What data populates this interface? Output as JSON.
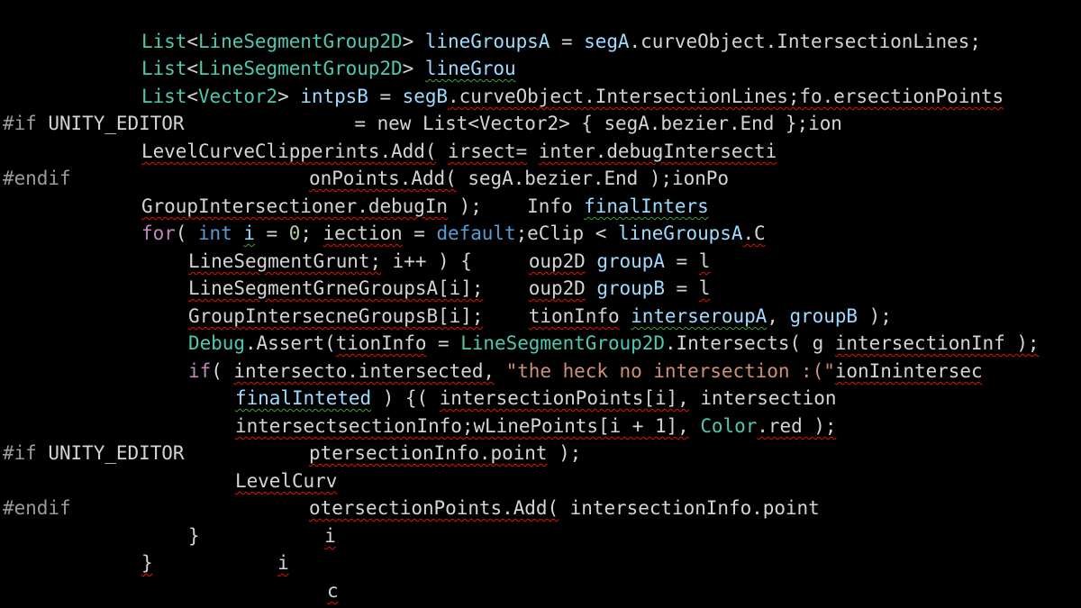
{
  "editor": {
    "theme_colors": {
      "background": "#000000",
      "type": "#4ec9b0",
      "keyword": "#569cd6",
      "control_keyword": "#c586c0",
      "variable": "#9cdcfe",
      "function": "#dcdcaa",
      "string": "#ce9178",
      "number": "#b5cea8",
      "preprocessor": "#9b9b9b",
      "plain": "#d4d4d4",
      "error_squiggle": "#e51400",
      "warning_squiggle": "#3fa33f"
    },
    "lines": [
      {
        "tokens": [
          {
            "t": "List",
            "c": "ty"
          },
          {
            "t": "<",
            "c": "tx"
          },
          {
            "t": "LineSegmentGroup2D",
            "c": "ty"
          },
          {
            "t": "> ",
            "c": "tx"
          },
          {
            "t": "lineGroupsA",
            "c": "va"
          },
          {
            "t": " = ",
            "c": "tx"
          },
          {
            "t": "segA",
            "c": "va"
          },
          {
            "t": ".curveObject.IntersectionLines;",
            "c": "tx"
          }
        ]
      },
      {
        "tokens": [
          {
            "t": "List",
            "c": "ty"
          },
          {
            "t": "<",
            "c": "tx"
          },
          {
            "t": "LineSegmentGroup2D",
            "c": "ty"
          },
          {
            "t": "> ",
            "c": "tx"
          },
          {
            "t": "lineGrou",
            "c": "va",
            "u": "warn"
          }
        ]
      },
      {
        "tokens": [
          {
            "t": "List",
            "c": "ty"
          },
          {
            "t": "<",
            "c": "tx"
          },
          {
            "t": "Vector2",
            "c": "ty"
          },
          {
            "t": "> ",
            "c": "tx"
          },
          {
            "t": "intpsB",
            "c": "va"
          },
          {
            "t": " = ",
            "c": "tx"
          },
          {
            "t": "segB",
            "c": "va"
          },
          {
            "t": ".curveObject.IntersectionLines;fo.ersectionPoints",
            "c": "tx",
            "u": "err"
          }
        ]
      },
      {
        "tokens": [
          {
            "t": "#if",
            "c": "pp"
          },
          {
            "t": " UNITY_EDITOR               ",
            "c": "tx"
          },
          {
            "t": "= new List<Vector2> { segA.bezier.End };ion",
            "c": "tx"
          }
        ]
      },
      {
        "tokens": [
          {
            "t": "LevelCurveClipperints.Add(",
            "c": "tx",
            "u": "err"
          },
          {
            "t": " ",
            "c": "tx"
          },
          {
            "t": "irsect=",
            "c": "tx",
            "u": "err"
          },
          {
            "t": " ",
            "c": "tx"
          },
          {
            "t": "inter.debugIntersecti",
            "c": "tx",
            "u": "err"
          }
        ]
      },
      {
        "tokens": [
          {
            "t": "#endif",
            "c": "pp"
          },
          {
            "t": "                     ",
            "c": "tx"
          },
          {
            "t": "onPoints.Add(",
            "c": "tx",
            "u": "err"
          },
          {
            "t": " segA.bezier.End );ionPo",
            "c": "tx"
          }
        ]
      },
      {
        "tokens": [
          {
            "t": "GroupIntersectioner.debugIn",
            "c": "tx",
            "u": "err"
          },
          {
            "t": " );    ",
            "c": "tx"
          },
          {
            "t": "Info ",
            "c": "tx"
          },
          {
            "t": "finalInters",
            "c": "va",
            "u": "warn"
          }
        ]
      },
      {
        "tokens": [
          {
            "t": "for",
            "c": "ct"
          },
          {
            "t": "( ",
            "c": "tx"
          },
          {
            "t": "int",
            "c": "kw"
          },
          {
            "t": " ",
            "c": "tx"
          },
          {
            "t": "i",
            "c": "va",
            "u": "warn"
          },
          {
            "t": " = ",
            "c": "tx"
          },
          {
            "t": "0",
            "c": "nu"
          },
          {
            "t": "; ",
            "c": "tx"
          },
          {
            "t": "iection",
            "c": "tx",
            "u": "err"
          },
          {
            "t": " = ",
            "c": "tx"
          },
          {
            "t": "default",
            "c": "kw"
          },
          {
            "t": ";eClip < ",
            "c": "tx"
          },
          {
            "t": "lineGroupsA",
            "c": "va"
          },
          {
            "t": ".C",
            "c": "tx",
            "u": "err"
          }
        ]
      },
      {
        "tokens": [
          {
            "t": "LineSegmentGrunt;",
            "c": "tx",
            "u": "err"
          },
          {
            "t": " i++ ) {     ",
            "c": "tx"
          },
          {
            "t": "oup2D",
            "c": "tx",
            "u": "err"
          },
          {
            "t": " ",
            "c": "tx"
          },
          {
            "t": "groupA",
            "c": "va"
          },
          {
            "t": " = ",
            "c": "tx"
          },
          {
            "t": "l",
            "c": "tx",
            "u": "err"
          }
        ]
      },
      {
        "tokens": [
          {
            "t": "LineSegmentGrneGroupsA[i];",
            "c": "tx",
            "u": "err"
          },
          {
            "t": "    ",
            "c": "tx"
          },
          {
            "t": "oup2D",
            "c": "tx",
            "u": "err"
          },
          {
            "t": " ",
            "c": "tx"
          },
          {
            "t": "groupB",
            "c": "va"
          },
          {
            "t": " = ",
            "c": "tx"
          },
          {
            "t": "l",
            "c": "tx",
            "u": "err"
          }
        ]
      },
      {
        "tokens": [
          {
            "t": "GroupIntersecneGroupsB[i];",
            "c": "tx",
            "u": "err"
          },
          {
            "t": "    ",
            "c": "tx"
          },
          {
            "t": "tionInfo",
            "c": "tx",
            "u": "err"
          },
          {
            "t": " ",
            "c": "tx"
          },
          {
            "t": "interseroupA",
            "c": "va",
            "u": "warn"
          },
          {
            "t": ", ",
            "c": "tx"
          },
          {
            "t": "groupB",
            "c": "va"
          },
          {
            "t": " );",
            "c": "tx"
          }
        ]
      },
      {
        "tokens": [
          {
            "t": "Debug",
            "c": "ty"
          },
          {
            "t": ".Assert(",
            "c": "tx"
          },
          {
            "t": "tionInfo",
            "c": "tx",
            "u": "err"
          },
          {
            "t": " = ",
            "c": "tx"
          },
          {
            "t": "LineSegmentGroup2D",
            "c": "ty"
          },
          {
            "t": ".Intersects( ",
            "c": "tx"
          },
          {
            "t": "g",
            "c": "tx"
          },
          {
            "t": " ",
            "c": "tx"
          },
          {
            "t": "intersectionInf",
            "c": "tx",
            "u": "err"
          },
          {
            "t": " );",
            "c": "tx",
            "u": "err"
          }
        ]
      },
      {
        "tokens": [
          {
            "t": "if",
            "c": "ct"
          },
          {
            "t": "( ",
            "c": "tx"
          },
          {
            "t": "intersecto.intersected,",
            "c": "tx",
            "u": "err"
          },
          {
            "t": " ",
            "c": "tx"
          },
          {
            "t": "\"the heck no intersection :(\"",
            "c": "st"
          },
          {
            "t": "ionInintersec",
            "c": "tx",
            "u": "err"
          }
        ]
      },
      {
        "tokens": [
          {
            "t": "finalInteted",
            "c": "va",
            "u": "warn"
          },
          {
            "t": " ) {( ",
            "c": "tx"
          },
          {
            "t": "intersectionPoints[i],",
            "c": "tx",
            "u": "err"
          },
          {
            "t": " intersection",
            "c": "tx"
          }
        ]
      },
      {
        "tokens": [
          {
            "t": "intersectsectionInfo;wLinePoints[i + 1],",
            "c": "tx",
            "u": "err"
          },
          {
            "t": " ",
            "c": "tx"
          },
          {
            "t": "Color",
            "c": "ty"
          },
          {
            "t": ".red );",
            "c": "tx",
            "u": "err"
          }
        ]
      },
      {
        "tokens": [
          {
            "t": "#if",
            "c": "pp"
          },
          {
            "t": " UNITY_EDITOR           ",
            "c": "tx"
          },
          {
            "t": "ptersectionInfo.point",
            "c": "tx",
            "u": "err"
          },
          {
            "t": " );",
            "c": "tx"
          }
        ]
      },
      {
        "tokens": [
          {
            "t": "LevelCurv",
            "c": "tx",
            "u": "err"
          }
        ]
      },
      {
        "tokens": [
          {
            "t": "#endif",
            "c": "pp"
          },
          {
            "t": "                     ",
            "c": "tx"
          },
          {
            "t": "otersectionPoints.Add(",
            "c": "tx",
            "u": "err"
          },
          {
            "t": " intersectionInfo.point",
            "c": "tx"
          }
        ]
      },
      {
        "tokens": [
          {
            "t": "}",
            "c": "tx"
          },
          {
            "t": "           ",
            "c": "tx"
          },
          {
            "t": "i",
            "c": "tx",
            "u": "err"
          }
        ]
      },
      {
        "tokens": [
          {
            "t": "}",
            "c": "tx",
            "u": "err"
          },
          {
            "t": "           ",
            "c": "tx"
          },
          {
            "t": "i",
            "c": "tx",
            "u": "err"
          }
        ]
      },
      {
        "tokens": [
          {
            "t": "c",
            "c": "tx",
            "u": "err"
          }
        ]
      }
    ]
  }
}
